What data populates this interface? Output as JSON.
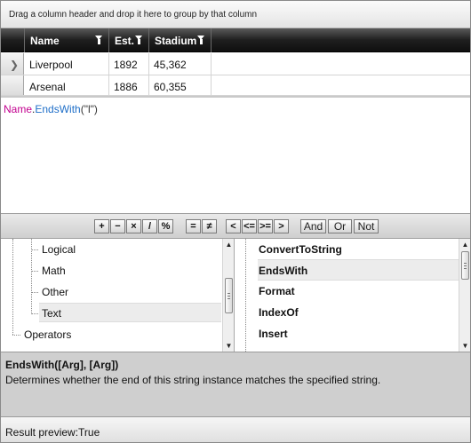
{
  "group_panel": {
    "hint": "Drag a column header and drop it here to group by that column"
  },
  "grid": {
    "columns": [
      {
        "label": "Name"
      },
      {
        "label": "Est."
      },
      {
        "label": "Stadium"
      }
    ],
    "rows": [
      {
        "current": true,
        "cells": [
          "Liverpool",
          "1892",
          "45,362"
        ]
      },
      {
        "current": false,
        "cells": [
          "Arsenal",
          "1886",
          "60,355"
        ]
      }
    ]
  },
  "expression": {
    "field": "Name",
    "dot": ".",
    "function": "EndsWith",
    "args": "(\"l\")"
  },
  "toolbar": {
    "operators": [
      "+",
      "−",
      "×",
      "/",
      "%",
      "=",
      "≠",
      "<",
      "<=",
      ">=",
      ">"
    ],
    "logic": [
      "And",
      "Or",
      "Not"
    ]
  },
  "tree": {
    "items": [
      {
        "label": "Logical",
        "selected": false
      },
      {
        "label": "Math",
        "selected": false
      },
      {
        "label": "Other",
        "selected": false
      },
      {
        "label": "Text",
        "selected": true
      },
      {
        "label": "Operators",
        "selected": false
      }
    ]
  },
  "functions": {
    "items": [
      {
        "label": "ConvertToString",
        "selected": false
      },
      {
        "label": "EndsWith",
        "selected": true
      },
      {
        "label": "Format",
        "selected": false
      },
      {
        "label": "IndexOf",
        "selected": false
      },
      {
        "label": "Insert",
        "selected": false
      }
    ]
  },
  "description": {
    "signature": "EndsWith([Arg], [Arg])",
    "text": "Determines whether the end of this string instance matches the specified string."
  },
  "result": {
    "text": "Result preview:True"
  }
}
